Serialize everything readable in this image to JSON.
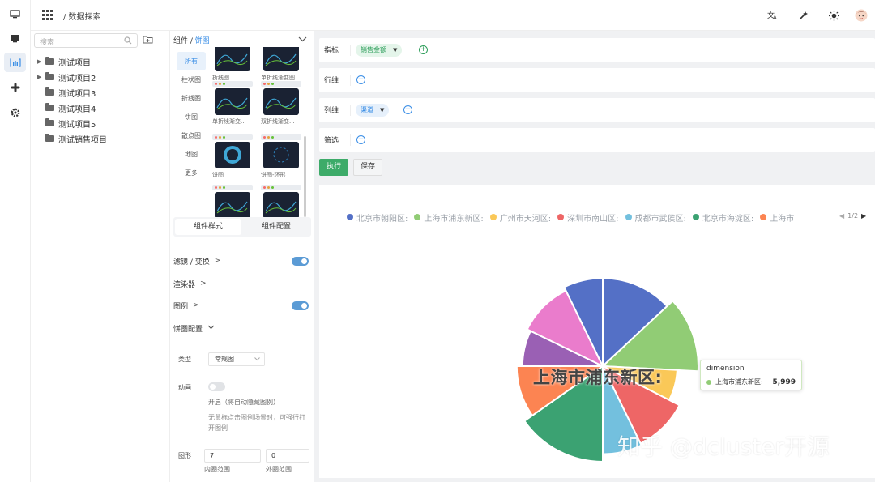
{
  "breadcrumb": "/ 数据探索",
  "colors": {
    "accent": "#3a8ee6",
    "run": "#3dab69"
  },
  "tree": {
    "search_placeholder": "搜索",
    "items": [
      {
        "label": "测试项目",
        "expandable": true
      },
      {
        "label": "测试项目2",
        "expandable": true
      },
      {
        "label": "测试项目3",
        "expandable": false
      },
      {
        "label": "测试项目4",
        "expandable": false
      },
      {
        "label": "测试项目5",
        "expandable": false
      },
      {
        "label": "测试销售项目",
        "expandable": false
      }
    ]
  },
  "config": {
    "crumb_prefix": "组件 / ",
    "crumb_current": "饼图",
    "categories": [
      "所有",
      "柱状图",
      "折线图",
      "饼图",
      "散点图",
      "地图",
      "更多"
    ],
    "thumbs": [
      "折线图",
      "单折线渐变图",
      "单折线渐变...",
      "双折线渐变...",
      "饼图",
      "饼图-环形"
    ],
    "tabs": [
      "组件样式",
      "组件配置"
    ],
    "sections": {
      "filter": "滤镜 / 变换",
      "renderer": "渲染器",
      "legend": "图例",
      "pie_config": "饼图配置"
    },
    "type_label": "类型",
    "type_value": "常规图",
    "animation_label": "动画",
    "animation_on_text": "开启（将自动隐藏图例）",
    "animation_hint": "无鼠标点击图例场景时，可强行打开图例",
    "shape_label": "图形",
    "inner_radius": "7",
    "outer_radius": "0",
    "inner_caption": "内圈范围",
    "outer_caption": "外圈范围"
  },
  "query": {
    "metric_label": "指标",
    "metric_pill": "销售金额",
    "row_label": "行维",
    "col_label": "列维",
    "col_pill": "渠道",
    "filter_label": "筛选",
    "run": "执行",
    "save": "保存"
  },
  "chart_data": {
    "type": "pie",
    "legend_position": "top",
    "legend_page": "1/2",
    "legend": [
      {
        "name": "北京市朝阳区:",
        "color": "#5470c6"
      },
      {
        "name": "上海市浦东新区:",
        "color": "#91cc75"
      },
      {
        "name": "广州市天河区:",
        "color": "#fac858"
      },
      {
        "name": "深圳市南山区:",
        "color": "#ee6666"
      },
      {
        "name": "成都市武侯区:",
        "color": "#73c0de"
      },
      {
        "name": "北京市海淀区:",
        "color": "#3ba272"
      },
      {
        "name": "上海市",
        "color": "#fc8452"
      }
    ],
    "slices": [
      {
        "color": "#5470c6",
        "angle_deg": 47,
        "radius_frac": 0.92
      },
      {
        "color": "#91cc75",
        "angle_deg": 46,
        "radius_frac": 1.0
      },
      {
        "color": "#fac858",
        "angle_deg": 24,
        "radius_frac": 0.78
      },
      {
        "color": "#ee6666",
        "angle_deg": 37,
        "radius_frac": 0.9
      },
      {
        "color": "#73c0de",
        "angle_deg": 26,
        "radius_frac": 0.92
      },
      {
        "color": "#3ba272",
        "angle_deg": 55,
        "radius_frac": 1.0
      },
      {
        "color": "#fc8452",
        "angle_deg": 35,
        "radius_frac": 0.9
      },
      {
        "color": "#9a60b4",
        "angle_deg": 26,
        "radius_frac": 0.84
      },
      {
        "color": "#ea7ccc",
        "angle_deg": 38,
        "radius_frac": 0.88
      },
      {
        "color": "#5470c6",
        "angle_deg": 26,
        "radius_frac": 0.92
      }
    ],
    "emphasis_label": "上海市浦东新区:",
    "tooltip": {
      "title": "dimension",
      "name": "上海市浦东新区:",
      "value": "5,999",
      "color": "#91cc75"
    }
  },
  "watermark": "知乎 @dcluster开源"
}
